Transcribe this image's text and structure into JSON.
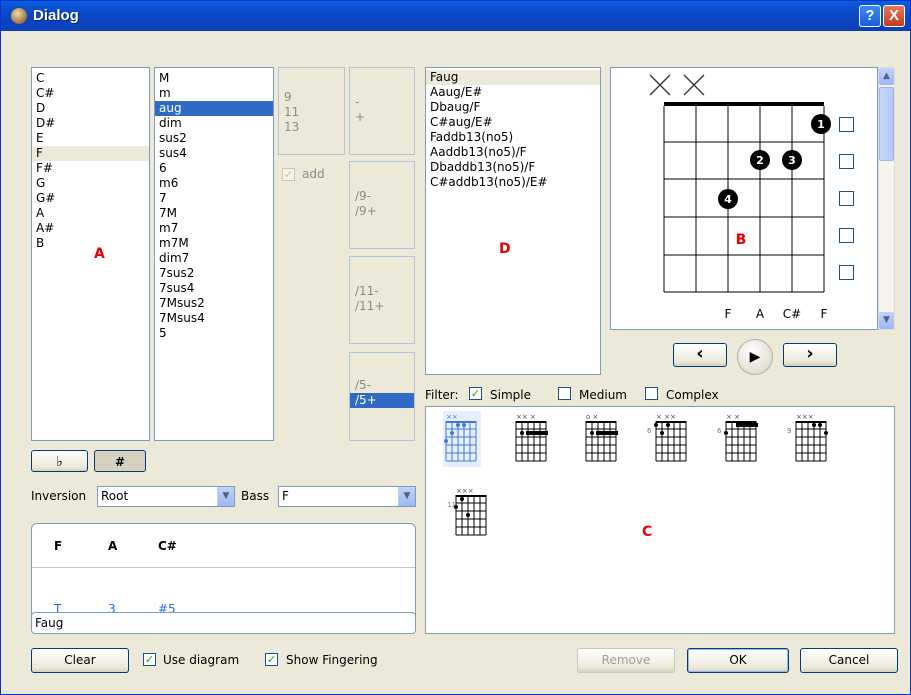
{
  "window": {
    "title": "Dialog",
    "help_label": "?",
    "close_label": "X"
  },
  "tonics": {
    "items": [
      "C",
      "C#",
      "D",
      "D#",
      "E",
      "F",
      "F#",
      "G",
      "G#",
      "A",
      "A#",
      "B"
    ],
    "selected_index": 5,
    "marker": "A"
  },
  "types": {
    "items": [
      "M",
      "m",
      "aug",
      "dim",
      "sus2",
      "sus4",
      "6",
      "m6",
      "7",
      "7M",
      "m7",
      "m7M",
      "dim7",
      "7sus2",
      "7sus4",
      "7Msus2",
      "7Msus4",
      "5"
    ],
    "selected_index": 2
  },
  "extensions": {
    "items": [
      "9",
      "11",
      "13"
    ]
  },
  "fifth_mod": {
    "items": [
      "-",
      "+"
    ]
  },
  "add": {
    "label": "add",
    "checked": true
  },
  "ninth": {
    "items": [
      "/9-",
      "/9+"
    ]
  },
  "eleventh": {
    "items": [
      "/11-",
      "/11+"
    ]
  },
  "fifth": {
    "items": [
      "/5-",
      "/5+"
    ],
    "selected_index": 1
  },
  "accidentals": {
    "flat_label": "♭",
    "sharp_label": "#"
  },
  "inversion": {
    "label": "Inversion",
    "value": "Root"
  },
  "bass": {
    "label": "Bass",
    "value": "F"
  },
  "notes_table": {
    "headers": [
      "F",
      "A",
      "C#"
    ],
    "intervals": [
      "T",
      "3",
      "#5"
    ]
  },
  "chord_name": "Faug",
  "names": {
    "items": [
      "Faug",
      "Aaug/E#",
      "Dbaug/F",
      "C#aug/E#",
      "Faddb13(no5)",
      "Aaddb13(no5)/F",
      "Dbaddb13(no5)/F",
      "C#addb13(no5)/E#"
    ],
    "selected_index": 0,
    "marker": "D"
  },
  "diagram": {
    "marker": "B",
    "string_marks": [
      "X",
      "X",
      "",
      "",
      "",
      ""
    ],
    "fret_labels": [
      "F",
      "A",
      "C#",
      "F"
    ],
    "fingers": [
      "1",
      "2",
      "3",
      "4"
    ],
    "string_checks": [
      false,
      false,
      false,
      false,
      false
    ]
  },
  "nav": {
    "prev": "‹",
    "play": "▶",
    "next": "›"
  },
  "filter": {
    "label": "Filter:",
    "options": [
      {
        "label": "Simple",
        "checked": true
      },
      {
        "label": "Medium",
        "checked": false
      },
      {
        "label": "Complex",
        "checked": false
      }
    ]
  },
  "shapes": {
    "marker": "C",
    "fret_numbers": [
      "6",
      "6",
      "9",
      "11"
    ]
  },
  "buttons": {
    "clear": "Clear",
    "use_diagram": "Use diagram",
    "show_fingering": "Show Fingering",
    "remove": "Remove",
    "ok": "OK",
    "cancel": "Cancel"
  },
  "colors": {
    "selection": "#316ac5",
    "marker": "#ee0000",
    "interval_text": "#1f6fd1"
  }
}
